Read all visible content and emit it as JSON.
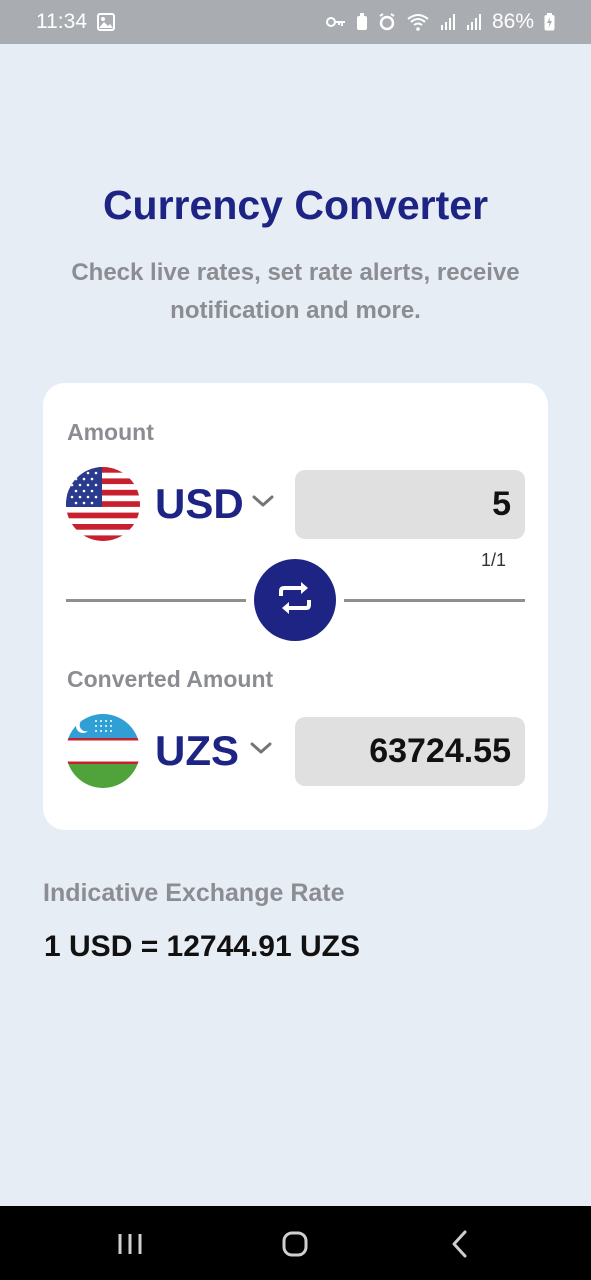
{
  "status_bar": {
    "time": "11:34",
    "battery": "86%",
    "icons": [
      "gallery-icon",
      "vpn-key-icon",
      "battery-saver-icon",
      "alarm-icon",
      "wifi-icon",
      "signal-icon",
      "signal-icon",
      "battery-charging-icon"
    ]
  },
  "header": {
    "title": "Currency Converter",
    "subtitle": "Check live rates, set rate alerts, receive notification and more."
  },
  "converter": {
    "amount_label": "Amount",
    "from_currency": "USD",
    "from_flag": "us-flag-icon",
    "amount_value": "5",
    "counter": "1/1",
    "converted_label": "Converted Amount",
    "to_currency": "UZS",
    "to_flag": "uz-flag-icon",
    "converted_value": "63724.55",
    "swap_icon": "swap-icon"
  },
  "rate": {
    "label": "Indicative Exchange Rate",
    "value": "1 USD = 12744.91 UZS"
  },
  "colors": {
    "accent": "#1d2484",
    "background": "#e7edf5",
    "muted_text": "#8b8d92",
    "input_bg": "#e0e0e0"
  },
  "nav_bar": {
    "buttons": [
      "recents-icon",
      "home-icon",
      "back-icon"
    ]
  }
}
